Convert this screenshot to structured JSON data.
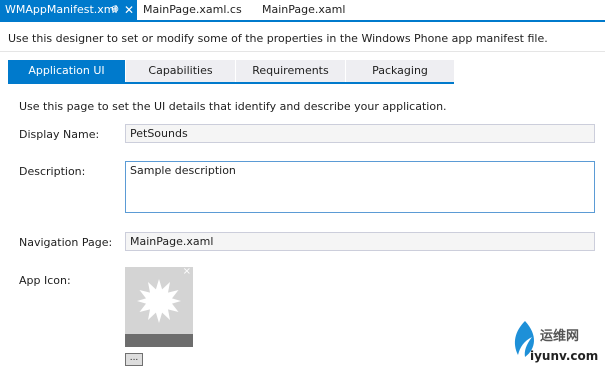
{
  "document_tabs": [
    {
      "label": "WMAppManifest.xml",
      "pin": "⊕",
      "close": "✕"
    },
    {
      "label": "MainPage.xaml.cs"
    },
    {
      "label": "MainPage.xaml"
    }
  ],
  "header": {
    "text": "Use this designer to set or modify some of the properties in the Windows Phone app manifest file."
  },
  "tabs": [
    {
      "label": "Application UI"
    },
    {
      "label": "Capabilities"
    },
    {
      "label": "Requirements"
    },
    {
      "label": "Packaging"
    }
  ],
  "page": {
    "intro": "Use this page to set the UI details that identify and describe your application.",
    "display_name": {
      "label": "Display Name:",
      "value": "PetSounds"
    },
    "description": {
      "label": "Description:",
      "value": "Sample description"
    },
    "navigation_page": {
      "label": "Navigation Page:",
      "value": "MainPage.xaml"
    },
    "app_icon": {
      "label": "App Icon:",
      "remove": "×",
      "browse": "..."
    }
  },
  "watermark": {
    "line1": "运维网",
    "line2": "iyunv.com"
  },
  "colors": {
    "accent": "#007acc",
    "tab_inactive": "#eeeef2",
    "icon_bg": "#d4d4d4"
  }
}
